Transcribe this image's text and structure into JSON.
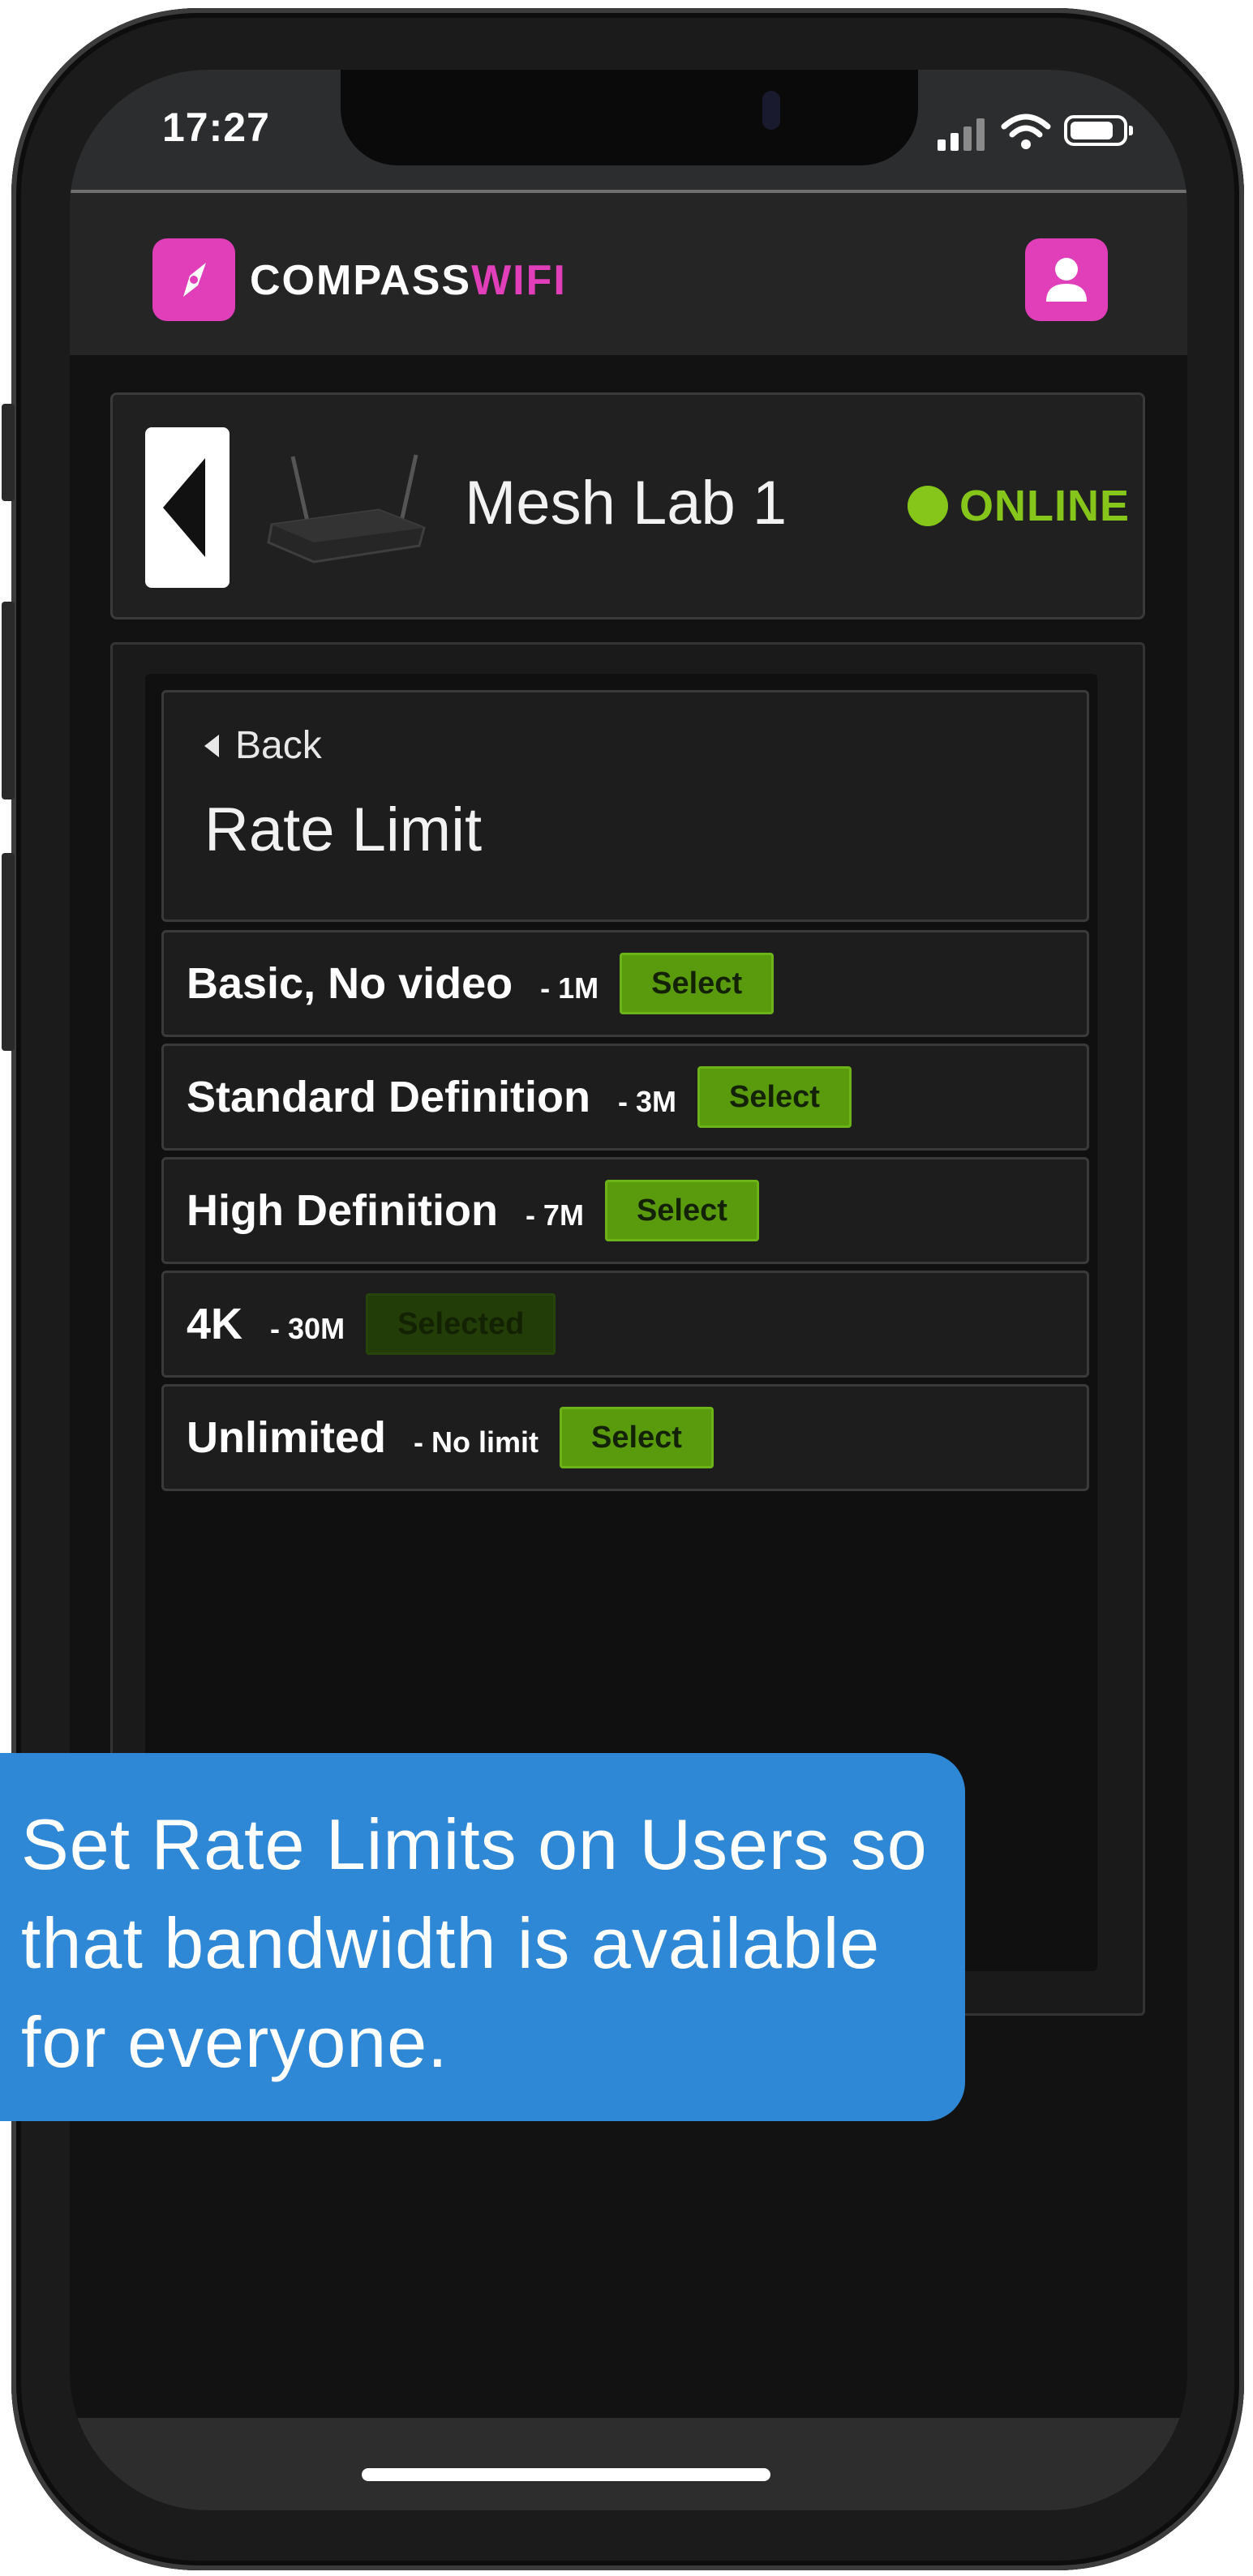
{
  "status_bar": {
    "time": "17:27",
    "icons": [
      "signal-icon",
      "wifi-icon",
      "battery-icon"
    ]
  },
  "app_bar": {
    "logo_part1": "COMPASS",
    "logo_part2": "WIFI",
    "brand_color": "#e03fb9",
    "logo_icon": "compass-icon",
    "user_icon": "user-icon"
  },
  "device": {
    "name": "Mesh Lab 1",
    "status": "ONLINE",
    "status_color": "#86c51a",
    "back_icon": "chevron-left-icon",
    "image_icon": "router-icon"
  },
  "rate_limit": {
    "back_label": "Back",
    "title": "Rate Limit",
    "options": [
      {
        "name": "Basic, No video",
        "rate": "- 1M",
        "button": "Select",
        "selected": false
      },
      {
        "name": "Standard Definition",
        "rate": "- 3M",
        "button": "Select",
        "selected": false
      },
      {
        "name": "High Definition",
        "rate": "- 7M",
        "button": "Select",
        "selected": false
      },
      {
        "name": "4K",
        "rate": "- 30M",
        "button": "Selected",
        "selected": true
      },
      {
        "name": "Unlimited",
        "rate": "- No limit",
        "button": "Select",
        "selected": false
      }
    ]
  },
  "callout": {
    "text": "Set Rate Limits on Users so that bandwidth is available for everyone.",
    "color": "#2f88d6"
  }
}
